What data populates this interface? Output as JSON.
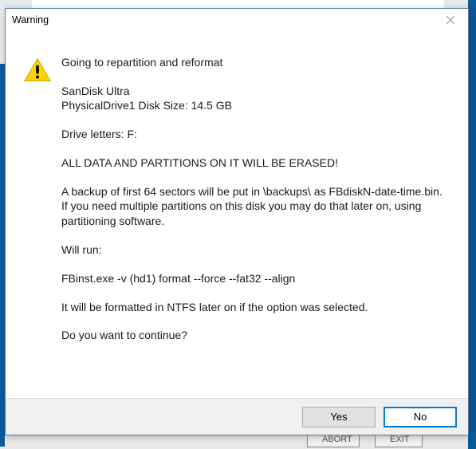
{
  "dialog": {
    "title": "Warning",
    "heading": "Going to repartition and reformat",
    "device_name": "SanDisk Ultra",
    "drive_line": "PhysicalDrive1   Disk Size: 14.5 GB",
    "letters_line": "Drive letters:   F:",
    "erase_warning": "ALL DATA AND PARTITIONS ON IT WILL BE ERASED!",
    "backup_line1": "A backup of first 64 sectors will be put in \\backups\\ as FBdiskN-date-time.bin.",
    "backup_line2": "If you need multiple partitions on this disk you may do that later on, using partitioning software.",
    "will_run": "Will run:",
    "command": "FBinst.exe  -v (hd1) format --force  --fat32 --align",
    "ntfs_note": "It will be formatted in NTFS later on if the option was selected.",
    "question": "Do you want to continue?",
    "yes": "Yes",
    "no": "No"
  },
  "background": {
    "btn1": "ABORT",
    "btn2": "EXIT"
  }
}
